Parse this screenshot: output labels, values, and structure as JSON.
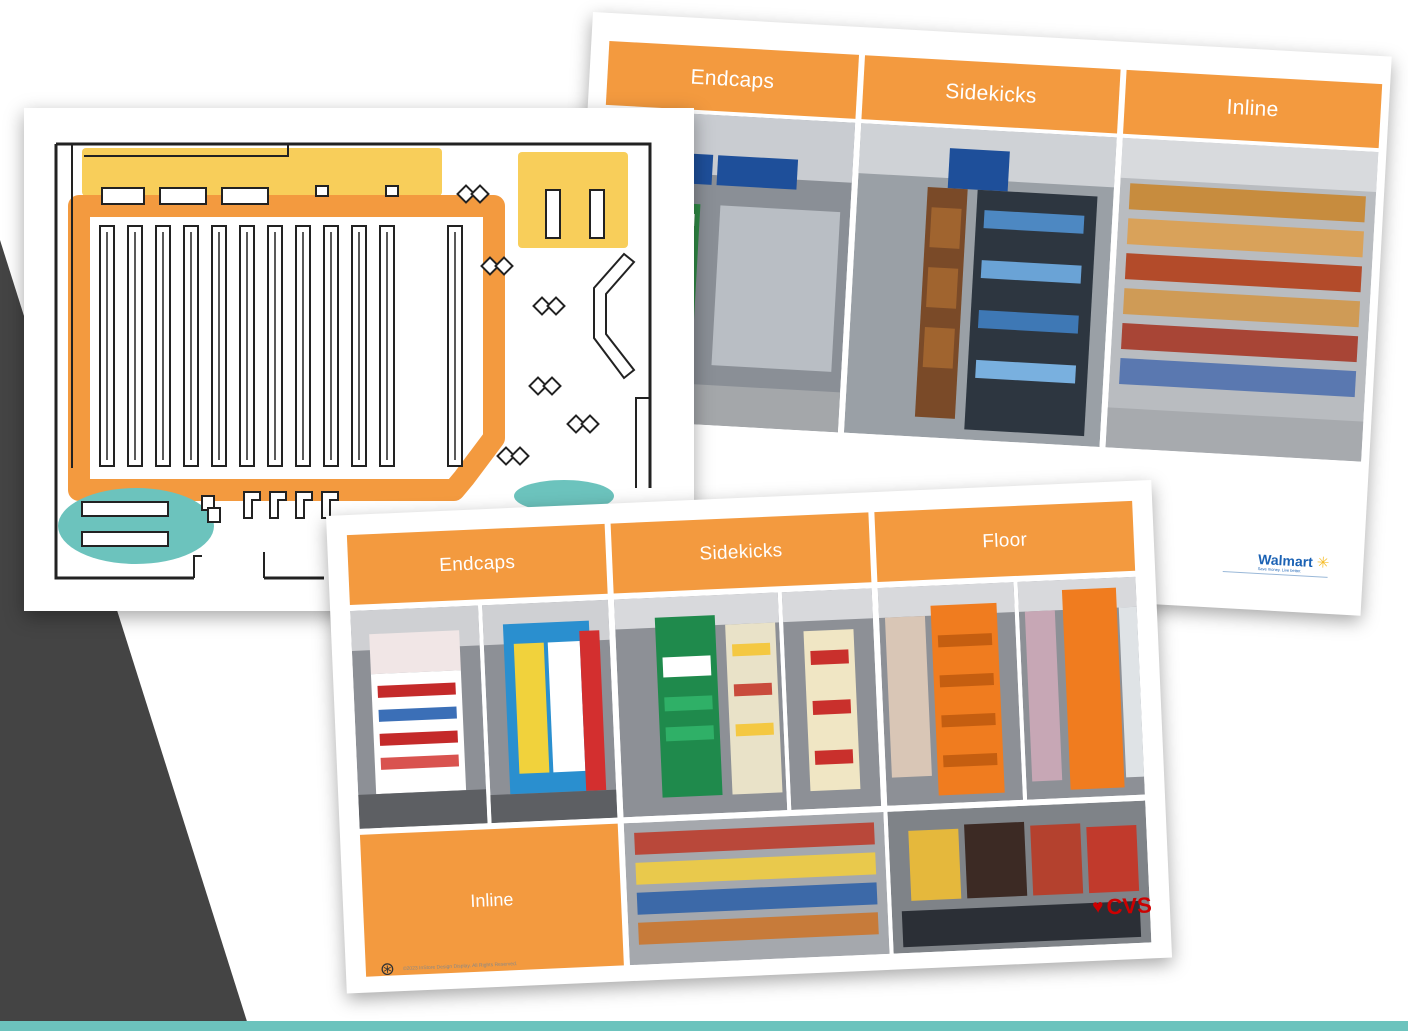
{
  "walmart_slide": {
    "columns": [
      "Endcaps",
      "Sidekicks",
      "Inline"
    ],
    "logo_word": "Walmart",
    "logo_tagline": "Save money. Live better."
  },
  "cvs_slide": {
    "columns": [
      "Endcaps",
      "Sidekicks",
      "Floor"
    ],
    "inline_label": "Inline",
    "logo_word": "CVS",
    "footer_copyright": "©2023 InStore Design Display. All Rights Reserved."
  },
  "colors": {
    "accent_orange": "#f39a3f",
    "highlight_yellow": "#f7c948",
    "highlight_teal": "#6cc3bd",
    "dark_gray": "#444444",
    "walmart_blue": "#1b62b4",
    "cvs_red": "#cc0000"
  }
}
